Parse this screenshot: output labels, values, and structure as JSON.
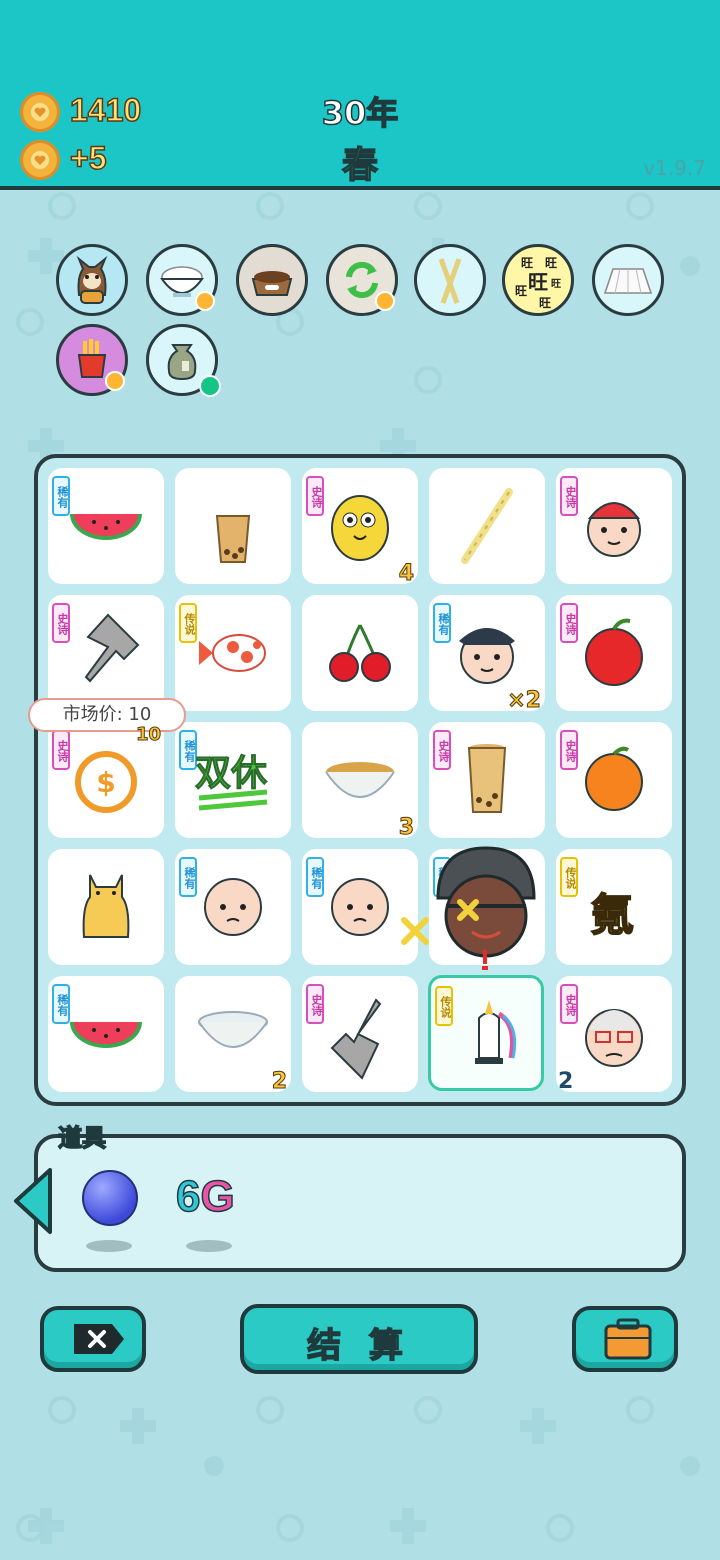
{
  "header": {
    "coins": "1410",
    "income": "+5",
    "year": "30年",
    "season": "春",
    "version": "v1.9.7"
  },
  "top_icons": [
    {
      "name": "shiba-dog-icon"
    },
    {
      "name": "rice-bowl-icon"
    },
    {
      "name": "dog-food-bowl-icon"
    },
    {
      "name": "refresh-icon"
    },
    {
      "name": "chopsticks-icon"
    },
    {
      "name": "wang-wang-icon"
    },
    {
      "name": "pleated-skirt-icon"
    },
    {
      "name": "french-fries-icon"
    },
    {
      "name": "trash-bag-icon"
    }
  ],
  "board": {
    "rarity_labels": {
      "rare": "稀有",
      "epic": "史诗",
      "legend": "传说"
    },
    "cells": [
      {
        "item": "watermelon",
        "rarity": "rare",
        "count": ""
      },
      {
        "item": "bubble-tea-cup",
        "rarity": "",
        "count": ""
      },
      {
        "item": "yellow-chick",
        "rarity": "epic",
        "count": "4"
      },
      {
        "item": "straw",
        "rarity": "",
        "count": ""
      },
      {
        "item": "red-hat-kid",
        "rarity": "epic",
        "count": ""
      },
      {
        "item": "pointing-hand",
        "rarity": "epic",
        "count": ""
      },
      {
        "item": "koi-fish",
        "rarity": "legend",
        "count": ""
      },
      {
        "item": "cherry",
        "rarity": "",
        "count": ""
      },
      {
        "item": "police-officer",
        "rarity": "rare",
        "count": "×2"
      },
      {
        "item": "apple",
        "rarity": "epic",
        "count": ""
      },
      {
        "item": "coin-refund",
        "rarity": "epic",
        "count": "10"
      },
      {
        "item": "double-rest",
        "rarity": "rare",
        "count": "",
        "text": "双休"
      },
      {
        "item": "soup-bowl",
        "rarity": "",
        "count": "3"
      },
      {
        "item": "bubble-tea-tall",
        "rarity": "epic",
        "count": ""
      },
      {
        "item": "orange",
        "rarity": "epic",
        "count": ""
      },
      {
        "item": "cat",
        "rarity": "",
        "count": ""
      },
      {
        "item": "bald-man",
        "rarity": "rare",
        "count": ""
      },
      {
        "item": "bald-man-2",
        "rarity": "rare",
        "count": ""
      },
      {
        "item": "thief-beanie",
        "rarity": "rare",
        "count": ""
      },
      {
        "item": "krypton-gold",
        "rarity": "legend",
        "count": "",
        "text": "氪"
      },
      {
        "item": "watermelon-2",
        "rarity": "rare",
        "count": ""
      },
      {
        "item": "empty-bowl",
        "rarity": "",
        "count": "2"
      },
      {
        "item": "pointing-hand-2",
        "rarity": "epic",
        "count": ""
      },
      {
        "item": "unicorn",
        "rarity": "legend",
        "count": ""
      },
      {
        "item": "grandpa",
        "rarity": "epic",
        "count": "2"
      }
    ],
    "tooltip": "市场价: 10"
  },
  "tools": {
    "title": "道具",
    "items": [
      {
        "name": "blue-orb"
      },
      {
        "name": "6g",
        "label_a": "6",
        "label_b": "G"
      }
    ]
  },
  "buttons": {
    "settle": "结 算"
  }
}
